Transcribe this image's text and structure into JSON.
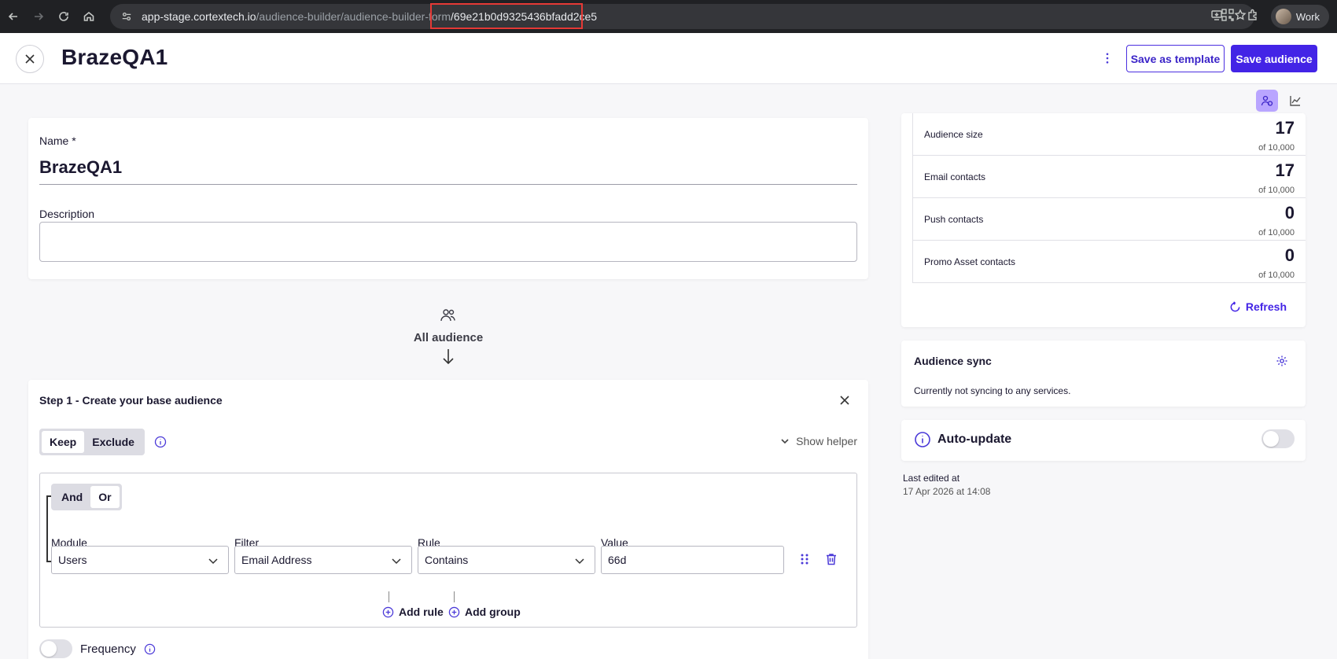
{
  "browser": {
    "url_host": "app-stage.cortextech.io",
    "url_path": "/audience-builder/audience-builder-form",
    "url_id": "/69e21b0d9325436bfadd2ce5",
    "profile_label": "Work"
  },
  "header": {
    "title": "BrazeQA1",
    "save_template_label": "Save as template",
    "save_audience_label": "Save audience"
  },
  "form": {
    "name_label": "Name *",
    "name_value": "BrazeQA1",
    "description_label": "Description",
    "description_value": ""
  },
  "flow": {
    "all_audience_label": "All audience"
  },
  "step": {
    "title": "Step 1 - Create your base audience",
    "keep_label": "Keep",
    "exclude_label": "Exclude",
    "show_helper_label": "Show helper",
    "and_label": "And",
    "or_label": "Or",
    "rule": {
      "module_label": "Module",
      "module_value": "Users",
      "filter_label": "Filter",
      "filter_value": "Email Address",
      "rule_label": "Rule",
      "rule_value": "Contains",
      "value_label": "Value",
      "value_value": "66d"
    },
    "add_rule_label": "Add rule",
    "add_group_label": "Add group",
    "frequency_label": "Frequency"
  },
  "stats": {
    "items": [
      {
        "label": "Audience size",
        "value": "17",
        "of": "of 10,000"
      },
      {
        "label": "Email contacts",
        "value": "17",
        "of": "of 10,000"
      },
      {
        "label": "Push contacts",
        "value": "0",
        "of": "of 10,000"
      },
      {
        "label": "Promo Asset contacts",
        "value": "0",
        "of": "of 10,000"
      }
    ],
    "refresh_label": "Refresh"
  },
  "sync": {
    "title": "Audience sync",
    "text": "Currently not syncing to any services."
  },
  "auto_update": {
    "label": "Auto-update",
    "enabled": false
  },
  "last_edited": {
    "label": "Last edited at",
    "value": "17 Apr 2026 at 14:08"
  },
  "colors": {
    "primary": "#4324e6",
    "accent_light": "#b9a5ff",
    "highlight": "#e53935"
  }
}
